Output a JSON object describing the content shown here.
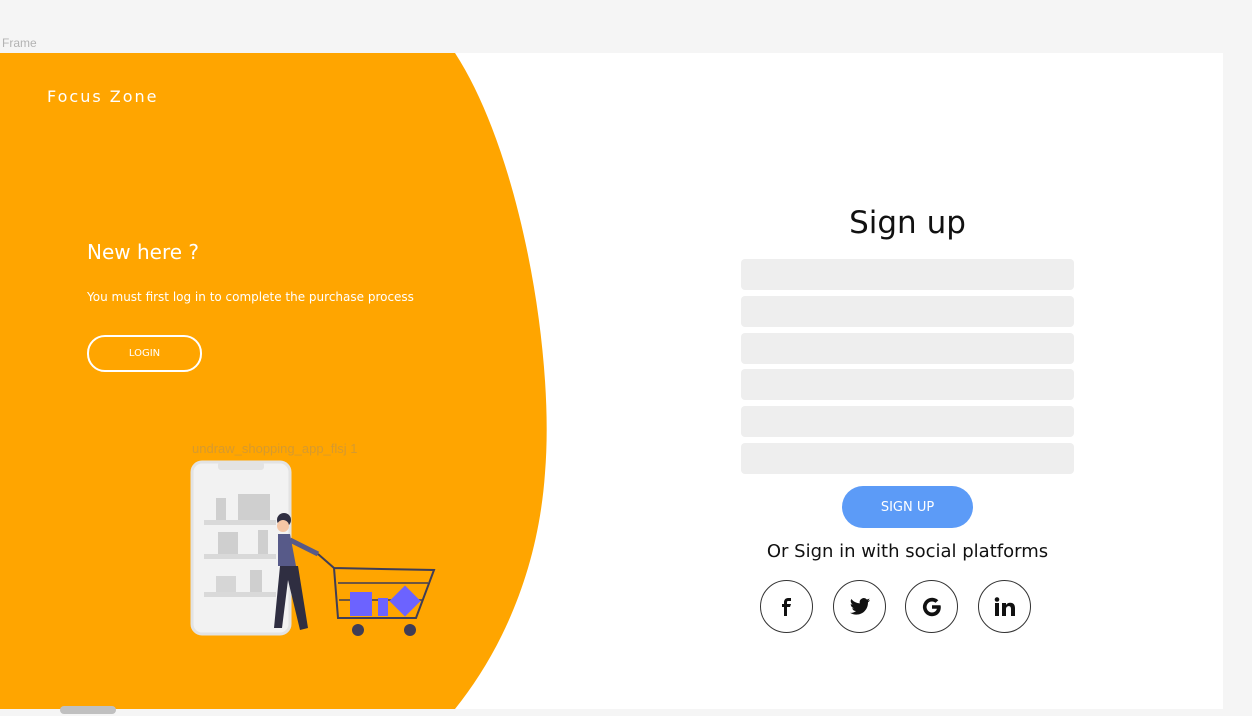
{
  "canvas": {
    "frame_label": "Frame"
  },
  "left_panel": {
    "brand": "Focus Zone",
    "heading": "New here ?",
    "subtext": "You must first log in to complete the purchase process",
    "login_label": "LOGIN",
    "image_caption": "undraw_shopping_app_flsj 1",
    "color": "#ffa500"
  },
  "form": {
    "title": "Sign up",
    "fields": [
      "",
      "",
      "",
      "",
      "",
      ""
    ],
    "submit_label": "SIGN UP",
    "social_text": "Or Sign in with social platforms",
    "social_icons": [
      "facebook-icon",
      "twitter-icon",
      "google-icon",
      "linkedin-icon"
    ],
    "accent": "#5c9bf7"
  }
}
